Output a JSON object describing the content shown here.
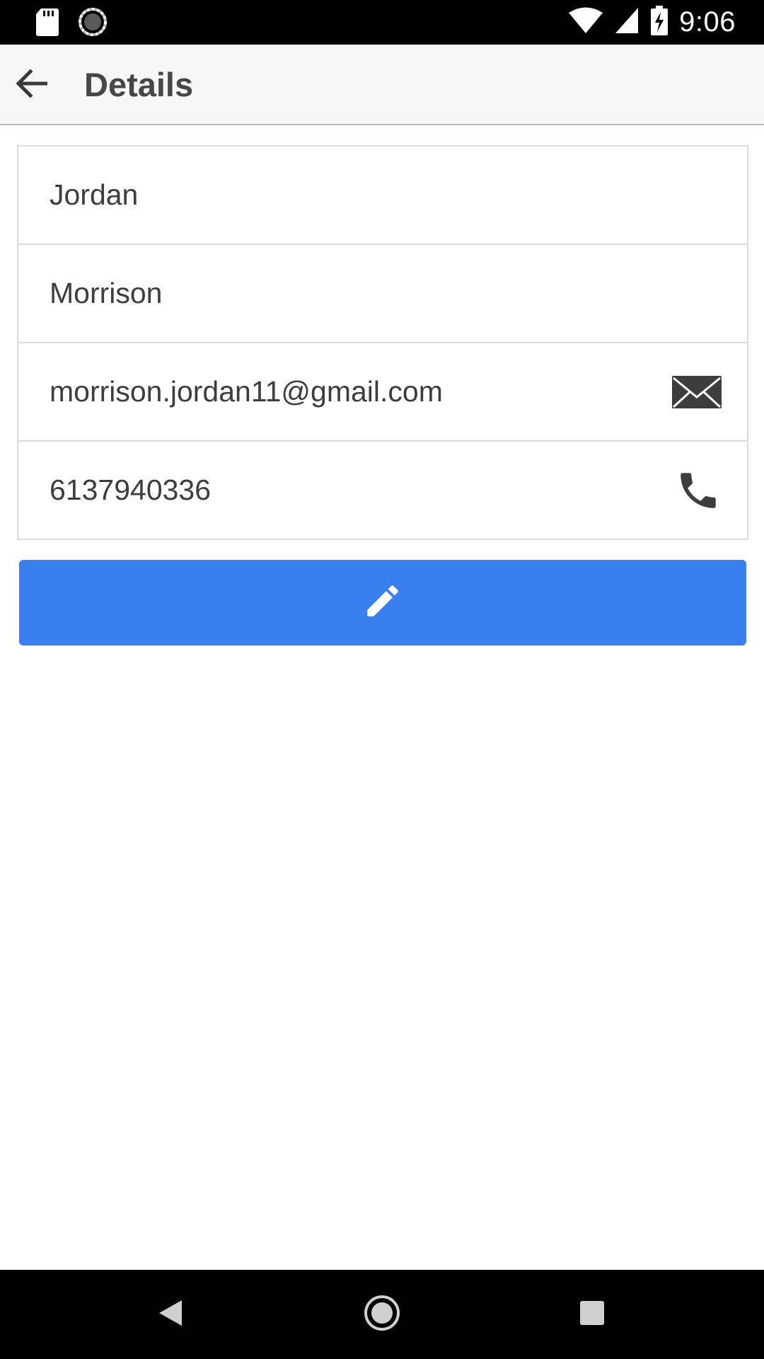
{
  "status_bar": {
    "time": "9:06",
    "left_icons": [
      "sd-card-icon",
      "sync-spinner-icon"
    ],
    "right_icons": [
      "wifi-icon",
      "cell-signal-icon",
      "battery-charging-icon"
    ]
  },
  "app_bar": {
    "back_icon": "arrow-back-icon",
    "title": "Details"
  },
  "fields": {
    "first_name": "Jordan",
    "last_name": "Morrison",
    "email": "morrison.jordan11@gmail.com",
    "email_icon": "mail-icon",
    "phone": "6137940336",
    "phone_icon": "phone-icon"
  },
  "edit_button": {
    "icon": "pencil-icon",
    "color": "#3a7ff0"
  },
  "nav_bar": {
    "back_icon": "nav-back-icon",
    "home_icon": "nav-home-icon",
    "recents_icon": "nav-recents-icon"
  },
  "colors": {
    "status_bar": "#000000",
    "app_bar": "#f7f7f7",
    "text": "#3d3d3d",
    "accent": "#3a7ff0"
  }
}
